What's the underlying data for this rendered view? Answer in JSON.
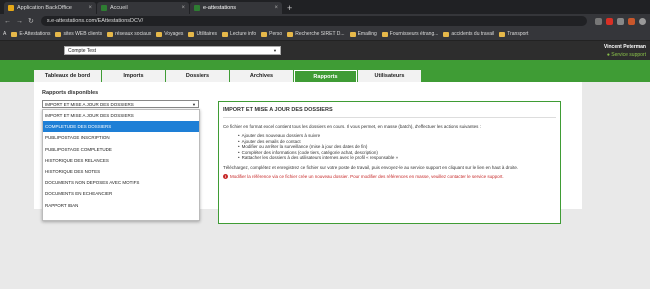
{
  "browser": {
    "tabs": [
      {
        "label": "Application BackOffice",
        "icon": "app-icon"
      },
      {
        "label": "Accueil",
        "icon": "check-icon"
      },
      {
        "label": "e-attestations",
        "icon": "check-icon"
      }
    ],
    "new_tab": "+",
    "url": "s.e-attestations.com/EAttestationsDCV/",
    "bookmarks": [
      "E-Attestations",
      "sites WEB clients",
      "réseaux sociaux",
      "Voyages",
      "Utilitaires",
      "Lecture info",
      "Perso",
      "Recherche SIRET D...",
      "Emailing",
      "Fournisseurs étrang...",
      "accidents du travail",
      "Transport"
    ]
  },
  "header": {
    "company": "Compte Test",
    "user_name": "Vincent Peterman",
    "user_link": "Service support"
  },
  "main_tabs": [
    {
      "label": "Tableaux de bord",
      "active": false
    },
    {
      "label": "Imports",
      "active": false
    },
    {
      "label": "Dossiers",
      "active": false
    },
    {
      "label": "Archives",
      "active": false
    },
    {
      "label": "Rapports",
      "active": true
    },
    {
      "label": "Utilisateurs",
      "active": false
    }
  ],
  "reports": {
    "title": "Rapports disponibles",
    "selected": "IMPORT ET MISE A JOUR DES DOSSIERS",
    "options": [
      "IMPORT ET MISE A JOUR DES DOSSIERS",
      "COMPLETUDE DES DOSSIERS",
      "PUBLIPOSTAGE INSCRIPTION",
      "PUBLIPOSTAGE COMPLETUDE",
      "HISTORIQUE DES RELANCES",
      "HISTORIQUE DES NOTES",
      "DOCUMENTS NON DEPOSES AVEC MOTIFS",
      "DOCUMENTS EN ECHEANCIER",
      "RAPPORT IBAN"
    ],
    "highlighted_index": 1
  },
  "panel": {
    "title": "IMPORT ET MISE A JOUR DES DOSSIERS",
    "intro": "Ce fichier en format excel contient tous les dossiers en cours. Il vous permet, en masse (batch), d'effectuer les actions suivantes :",
    "bullets": [
      "Ajouter des nouveaux dossiers à suivre",
      "Ajouter des emails de contact",
      "Modifier ou arrêter la surveillance (mise à jour des dates de fin)",
      "Compléter des informations (code tiers, catégorie achat, description)",
      "Rattacher les dossiers à des utilisateurs internes avec le profil « responsable »"
    ],
    "instructions": "Téléchargez, complétez et enregistrez ce fichier sur votre poste de travail, puis envoyez-le au service support en cliquant sur le lien en haut à droite.",
    "warning": "Modifier la référence via ce fichier crée un nouveau dossier. Pour modifier des références en masse, veuillez contacter le service support."
  },
  "colors": {
    "brand_green": "#3f9c35",
    "selection_blue": "#1e7fd6",
    "warning_red": "#c62828"
  }
}
